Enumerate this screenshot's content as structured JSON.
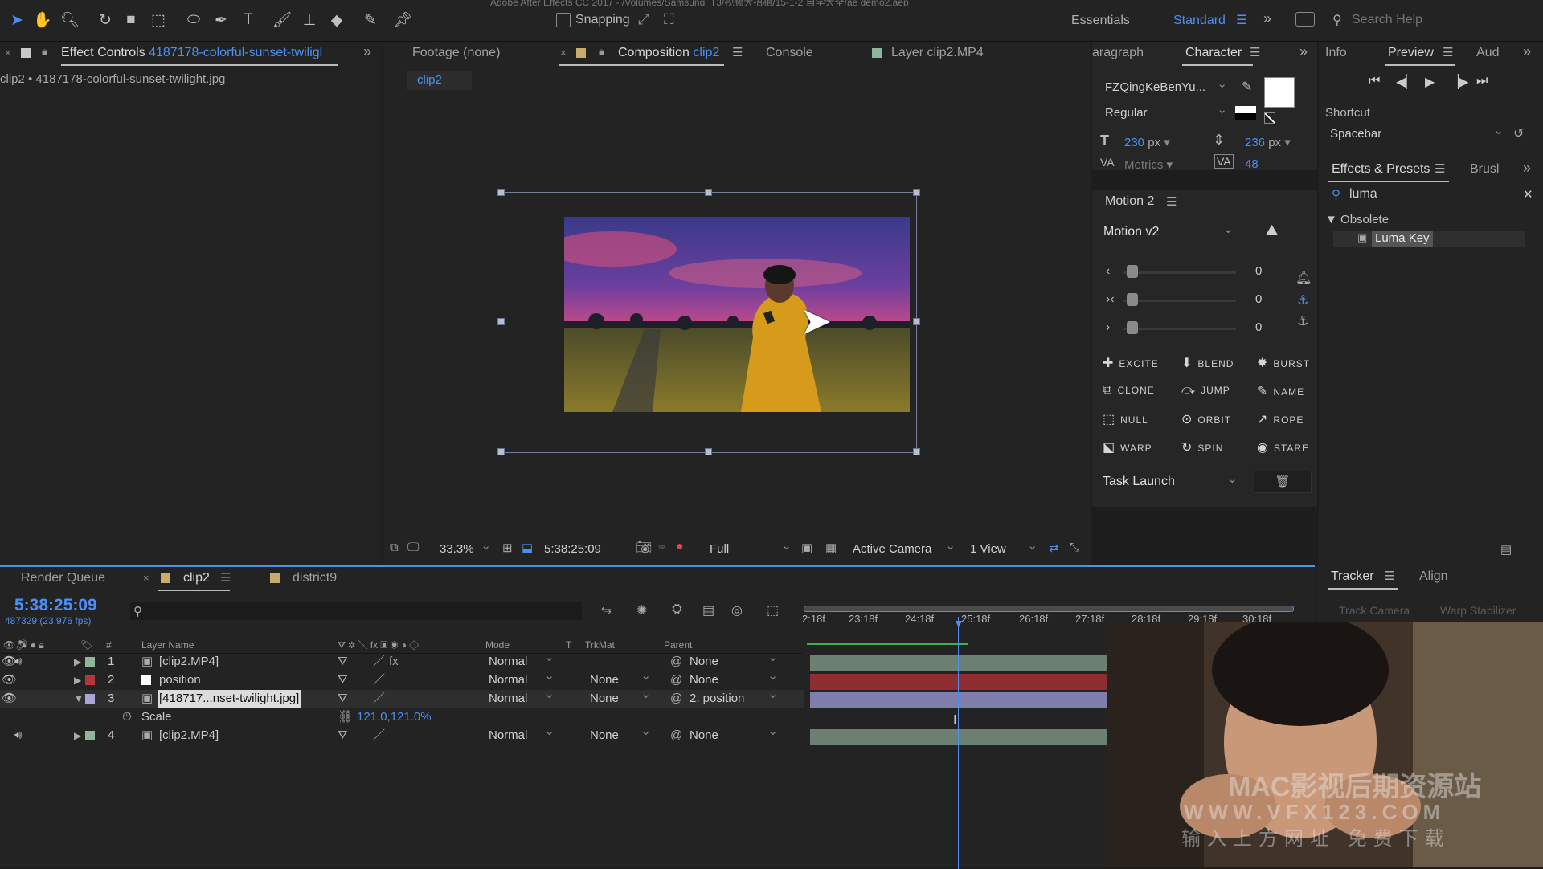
{
  "app": {
    "title_partial": "Adobe After Effects CC 2017 - /Volumes/Samsung_T3/视频大招相/15-1-2 自学大全/ae demo2.aep"
  },
  "toolbar": {
    "snapping_label": "Snapping",
    "snapping_checked": false,
    "workspaces": [
      "Essentials",
      "Standard"
    ],
    "active_workspace": "Standard",
    "search_help_placeholder": "Search Help"
  },
  "effect_controls": {
    "tab_prefix": "Effect Controls",
    "tab_name": "4187178-colorful-sunset-twiligl",
    "subtitle": "clip2 • 4187178-colorful-sunset-twilight.jpg"
  },
  "viewer": {
    "tabs": [
      "Footage (none)",
      "Composition",
      "Console",
      "Layer clip2.MP4"
    ],
    "composition_name": "clip2",
    "breadcrumb": "clip2",
    "zoom": "33.3%",
    "timecode": "5:38:25:09",
    "resolution": "Full",
    "camera": "Active Camera",
    "views": "1 View"
  },
  "character": {
    "tab_paragraph": "aragraph",
    "tab_character": "Character",
    "font": "FZQingKeBenYu...",
    "style": "Regular",
    "font_size": "230",
    "font_size_unit": "px",
    "leading": "236",
    "leading_unit": "px",
    "kerning": "Metrics",
    "tracking": "48"
  },
  "motion": {
    "panel_title": "Motion 2",
    "preset": "Motion v2",
    "sliders": [
      {
        "value": 0
      },
      {
        "value": 0
      },
      {
        "value": 0
      }
    ],
    "buttons": [
      "EXCITE",
      "BLEND",
      "BURST",
      "CLONE",
      "JUMP",
      "NAME",
      "NULL",
      "ORBIT",
      "ROPE",
      "WARP",
      "SPIN",
      "STARE"
    ],
    "task": "Task Launch"
  },
  "info_preview": {
    "tabs": [
      "Info",
      "Preview",
      "Aud"
    ],
    "shortcut_label": "Shortcut",
    "shortcut_value": "Spacebar"
  },
  "effects_presets": {
    "tabs": [
      "Effects & Presets",
      "Brusl"
    ],
    "search_value": "luma",
    "group": "Obsolete",
    "item": "Luma Key"
  },
  "timeline": {
    "tabs": [
      "Render Queue",
      "clip2",
      "district9"
    ],
    "timecode": "5:38:25:09",
    "fps": "487329 (23.976 fps)",
    "columns": {
      "num": "#",
      "layer_name": "Layer Name",
      "mode": "Mode",
      "t": "T",
      "trkmat": "TrkMat",
      "parent": "Parent"
    },
    "ruler": [
      "2:18f",
      "23:18f",
      "24:18f",
      "25:18f",
      "26:18f",
      "27:18f",
      "28:18f",
      "29:18f",
      "30:18f"
    ],
    "layers": [
      {
        "num": "1",
        "name": "[clip2.MP4]",
        "color": "#8fb59c",
        "mode": "Normal",
        "trkmat": "",
        "parent": "None"
      },
      {
        "num": "2",
        "name": "position",
        "color": "#b5373a",
        "mode": "Normal",
        "trkmat": "None",
        "parent": "None"
      },
      {
        "num": "3",
        "name": "[418717...nset-twilight.jpg]",
        "color": "#a7a6d6",
        "mode": "Normal",
        "trkmat": "None",
        "parent": "2. position"
      },
      {
        "num": "4",
        "name": "[clip2.MP4]",
        "color": "#8fb59c",
        "mode": "Normal",
        "trkmat": "None",
        "parent": "None"
      }
    ],
    "scale_label": "Scale",
    "scale_value": "121.0,121.0%"
  },
  "tracker": {
    "tabs": [
      "Tracker",
      "Align"
    ],
    "buttons": [
      "Track Camera",
      "Warp Stabilizer"
    ]
  },
  "watermark": {
    "line1": "MAC影视后期资源站",
    "line2": "WWW.VFX123.COM",
    "line3": "输入上方网址 免费下载"
  }
}
